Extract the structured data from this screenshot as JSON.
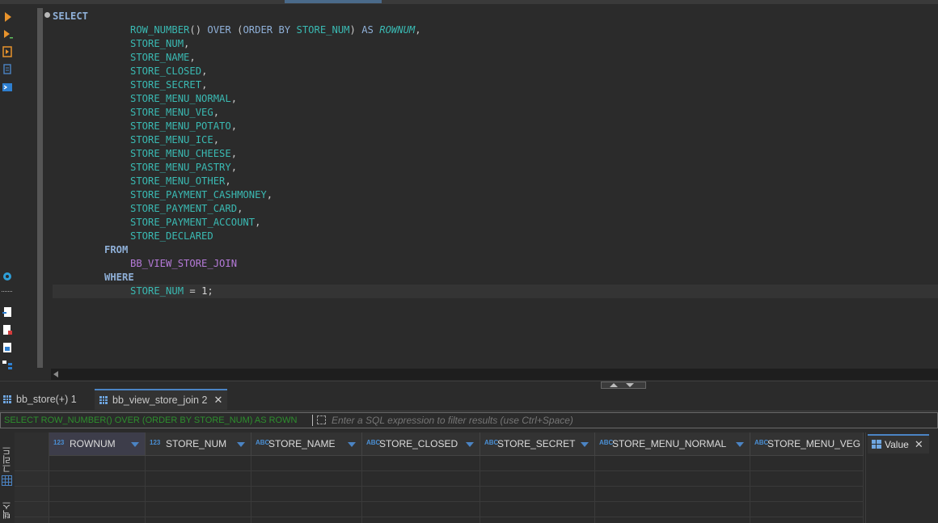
{
  "editor": {
    "lines": [
      {
        "indent": 0,
        "tokens": [
          {
            "t": "SELECT",
            "c": "kw"
          }
        ]
      },
      {
        "indent": 12,
        "tokens": [
          {
            "t": "ROW_NUMBER",
            "c": "col"
          },
          {
            "t": "() ",
            "c": "punct"
          },
          {
            "t": "OVER",
            "c": "kw2"
          },
          {
            "t": " (",
            "c": "punct"
          },
          {
            "t": "ORDER BY",
            "c": "kw2"
          },
          {
            "t": " ",
            "c": "punct"
          },
          {
            "t": "STORE_NUM",
            "c": "col"
          },
          {
            "t": ") ",
            "c": "punct"
          },
          {
            "t": "AS",
            "c": "kw2"
          },
          {
            "t": " ",
            "c": "punct"
          },
          {
            "t": "ROWNUM",
            "c": "alias"
          },
          {
            "t": ",",
            "c": "punct"
          }
        ]
      },
      {
        "indent": 12,
        "tokens": [
          {
            "t": "STORE_NUM",
            "c": "col"
          },
          {
            "t": ",",
            "c": "punct"
          }
        ]
      },
      {
        "indent": 12,
        "tokens": [
          {
            "t": "STORE_NAME",
            "c": "col"
          },
          {
            "t": ",",
            "c": "punct"
          }
        ]
      },
      {
        "indent": 12,
        "tokens": [
          {
            "t": "STORE_CLOSED",
            "c": "col"
          },
          {
            "t": ",",
            "c": "punct"
          }
        ]
      },
      {
        "indent": 12,
        "tokens": [
          {
            "t": "STORE_SECRET",
            "c": "col"
          },
          {
            "t": ",",
            "c": "punct"
          }
        ]
      },
      {
        "indent": 12,
        "tokens": [
          {
            "t": "STORE_MENU_NORMAL",
            "c": "col"
          },
          {
            "t": ",",
            "c": "punct"
          }
        ]
      },
      {
        "indent": 12,
        "tokens": [
          {
            "t": "STORE_MENU_VEG",
            "c": "col"
          },
          {
            "t": ",",
            "c": "punct"
          }
        ]
      },
      {
        "indent": 12,
        "tokens": [
          {
            "t": "STORE_MENU_POTATO",
            "c": "col"
          },
          {
            "t": ",",
            "c": "punct"
          }
        ]
      },
      {
        "indent": 12,
        "tokens": [
          {
            "t": "STORE_MENU_ICE",
            "c": "col"
          },
          {
            "t": ",",
            "c": "punct"
          }
        ]
      },
      {
        "indent": 12,
        "tokens": [
          {
            "t": "STORE_MENU_CHEESE",
            "c": "col"
          },
          {
            "t": ",",
            "c": "punct"
          }
        ]
      },
      {
        "indent": 12,
        "tokens": [
          {
            "t": "STORE_MENU_PASTRY",
            "c": "col"
          },
          {
            "t": ",",
            "c": "punct"
          }
        ]
      },
      {
        "indent": 12,
        "tokens": [
          {
            "t": "STORE_MENU_OTHER",
            "c": "col"
          },
          {
            "t": ",",
            "c": "punct"
          }
        ]
      },
      {
        "indent": 12,
        "tokens": [
          {
            "t": "STORE_PAYMENT_CASHMONEY",
            "c": "col"
          },
          {
            "t": ",",
            "c": "punct"
          }
        ]
      },
      {
        "indent": 12,
        "tokens": [
          {
            "t": "STORE_PAYMENT_CARD",
            "c": "col"
          },
          {
            "t": ",",
            "c": "punct"
          }
        ]
      },
      {
        "indent": 12,
        "tokens": [
          {
            "t": "STORE_PAYMENT_ACCOUNT",
            "c": "col"
          },
          {
            "t": ",",
            "c": "punct"
          }
        ]
      },
      {
        "indent": 12,
        "tokens": [
          {
            "t": "STORE_DECLARED",
            "c": "col"
          }
        ]
      },
      {
        "indent": 8,
        "tokens": [
          {
            "t": "FROM",
            "c": "kw"
          }
        ]
      },
      {
        "indent": 12,
        "tokens": [
          {
            "t": "BB_VIEW_STORE_JOIN",
            "c": "obj"
          }
        ]
      },
      {
        "indent": 8,
        "tokens": [
          {
            "t": "WHERE",
            "c": "kw"
          }
        ]
      },
      {
        "indent": 12,
        "tokens": [
          {
            "t": "STORE_NUM",
            "c": "col"
          },
          {
            "t": " = ",
            "c": "punct"
          },
          {
            "t": "1",
            "c": "num"
          },
          {
            "t": ";",
            "c": "punct"
          }
        ]
      }
    ]
  },
  "result_tabs": {
    "tab1_label": "bb_store(+) 1",
    "tab2_label": "bb_view_store_join 2",
    "close_glyph": "✕"
  },
  "filter": {
    "sql_preview": "SELECT ROW_NUMBER() OVER (ORDER BY STORE_NUM) AS ROWN",
    "placeholder": "Enter a SQL expression to filter results (use Ctrl+Space)"
  },
  "grid": {
    "columns": [
      {
        "type": "123",
        "name": "ROWNUM"
      },
      {
        "type": "123",
        "name": "STORE_NUM"
      },
      {
        "type": "ABC",
        "name": "STORE_NAME"
      },
      {
        "type": "ABC",
        "name": "STORE_CLOSED"
      },
      {
        "type": "ABC",
        "name": "STORE_SECRET"
      },
      {
        "type": "ABC",
        "name": "STORE_MENU_NORMAL"
      },
      {
        "type": "ABC",
        "name": "STORE_MENU_VEG"
      }
    ]
  },
  "side_tabs": {
    "grid_label": "그리드",
    "text_label": "텍스트"
  },
  "value_panel": {
    "label": "Value"
  },
  "icons": [
    "execute-icon",
    "execute-new-tab-icon",
    "explain-plan-icon",
    "load-script-icon",
    "console-icon",
    "transaction-icon",
    "export-icon",
    "import-icon",
    "script-icon",
    "grid-icon",
    "filter-icon",
    "close-icon"
  ]
}
